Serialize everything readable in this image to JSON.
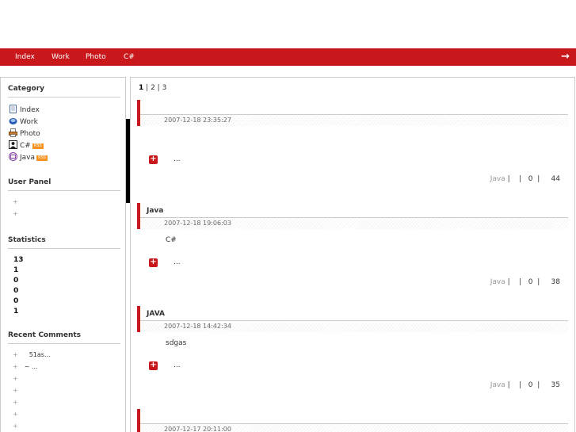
{
  "nav": {
    "items": [
      "Index",
      "Work",
      "Photo",
      "C#"
    ],
    "exit_icon": "arrow-right-icon"
  },
  "sidebar": {
    "category": {
      "title": "Category",
      "items": [
        {
          "label": "Index",
          "icon": "page-icon"
        },
        {
          "label": "Work",
          "icon": "disc-icon"
        },
        {
          "label": "Photo",
          "icon": "printer-icon"
        },
        {
          "label": "C#",
          "icon": "user-icon",
          "feed": true
        },
        {
          "label": "Java",
          "icon": "mail-icon",
          "feed": true
        }
      ]
    },
    "user_panel": {
      "title": "User Panel",
      "items": [
        "+",
        "+"
      ]
    },
    "statistics": {
      "title": "Statistics",
      "values": [
        "13",
        "1",
        "0",
        "0",
        "0",
        "1"
      ]
    },
    "recent_comments": {
      "title": "Recent Comments",
      "items": [
        {
          "bullet": "+",
          "text": "51as..."
        },
        {
          "bullet": "+",
          "text": "~   ..."
        },
        {
          "bullet": "+",
          "text": ""
        },
        {
          "bullet": "+",
          "text": ""
        },
        {
          "bullet": "+",
          "text": ""
        },
        {
          "bullet": "+",
          "text": ""
        },
        {
          "bullet": "+",
          "text": ""
        }
      ]
    }
  },
  "main": {
    "pager": {
      "current": "1",
      "sep": "|",
      "pages": [
        "2",
        "3"
      ]
    },
    "posts": [
      {
        "title": "",
        "date": "2007-12-18 23:35:27",
        "body": "",
        "more": "...",
        "category": "Java",
        "sep1": "|",
        "sep2": "|",
        "comments": "0",
        "sep3": "|",
        "views": "44"
      },
      {
        "title": "Java",
        "date": "2007-12-18 19:06:03",
        "body": "C#",
        "more": "...",
        "category": "Java",
        "sep1": "|",
        "sep2": "|",
        "comments": "0",
        "sep3": "|",
        "views": "38"
      },
      {
        "title": "JAVA",
        "date": "2007-12-18 14:42:34",
        "body": "sdgas",
        "more": "...",
        "category": "Java",
        "sep1": "|",
        "sep2": "|",
        "comments": "0",
        "sep3": "|",
        "views": "35"
      },
      {
        "title": "",
        "date": "2007-12-17 20:11:00"
      }
    ]
  },
  "colors": {
    "accent": "#c8181c",
    "feed": "#f7931e"
  }
}
